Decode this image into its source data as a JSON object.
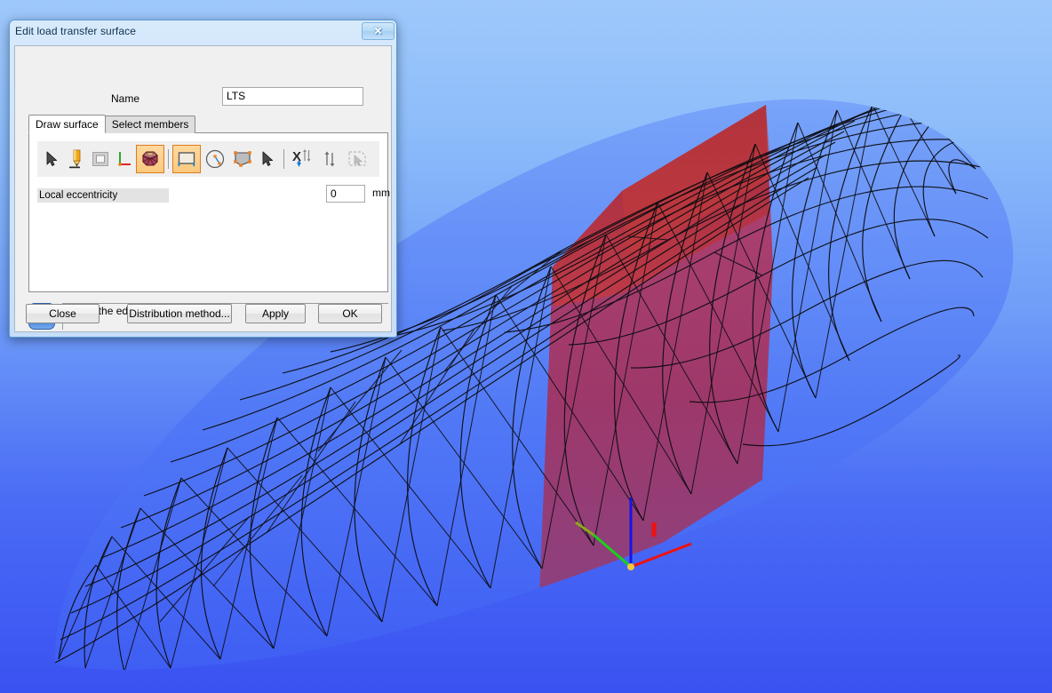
{
  "window": {
    "title": "Edit load transfer surface",
    "close_label": "✕",
    "close_icon": "close-icon"
  },
  "form": {
    "name_label": "Name",
    "name_value": "LTS"
  },
  "tabs": [
    {
      "label": "Draw surface",
      "active": true
    },
    {
      "label": "Select members",
      "active": false
    }
  ],
  "toolbar": {
    "items": [
      {
        "name": "select-arrow-icon",
        "icon": "arrow",
        "selected": false,
        "enabled": true
      },
      {
        "name": "draw-pencil-icon",
        "icon": "pencil",
        "selected": false,
        "enabled": true
      },
      {
        "name": "rectangle-plate-icon",
        "icon": "plate",
        "selected": false,
        "enabled": true
      },
      {
        "name": "coordinate-axes-icon",
        "icon": "axes",
        "selected": false,
        "enabled": true
      },
      {
        "name": "polygon-mesh-icon",
        "icon": "polymesh",
        "selected": true,
        "enabled": true
      },
      {
        "name": "draw-rectangle-icon",
        "icon": "rect-draw",
        "selected": true,
        "enabled": true
      },
      {
        "name": "draw-circle-icon",
        "icon": "circle-draw",
        "selected": false,
        "enabled": true
      },
      {
        "name": "edit-nodes-icon",
        "icon": "nodes-edit",
        "selected": false,
        "enabled": true
      },
      {
        "name": "pick-arrow-icon",
        "icon": "arrow",
        "selected": false,
        "enabled": true
      },
      {
        "name": "separator",
        "icon": "separator",
        "selected": false,
        "enabled": true
      },
      {
        "name": "delete-x-icon",
        "icon": "x-arrows",
        "selected": false,
        "enabled": true
      },
      {
        "name": "move-vertical-icon",
        "icon": "updown",
        "selected": false,
        "enabled": true
      },
      {
        "name": "select-region-icon",
        "icon": "region-pick",
        "selected": false,
        "enabled": false
      }
    ]
  },
  "eccentricity": {
    "label": "Local eccentricity",
    "value": "0",
    "unit": "mm"
  },
  "info": {
    "icon": "info-icon",
    "message": "Select the edge!"
  },
  "buttons": {
    "close": "Close",
    "distribution": "Distribution method...",
    "apply": "Apply",
    "ok": "OK"
  },
  "viewport": {
    "name": "3d-model-viewport",
    "background_top": "#9ec8fb",
    "background_bottom": "#3a52f2",
    "mesh_line_color": "#0d0d12",
    "surface_color": "#4a6cf5",
    "selected_surface_color": "#b32a55",
    "highlight_surface_color": "#c03030",
    "axes": {
      "x_color": "#ee1111",
      "y_color": "#22cc22",
      "z_color": "#1111ee",
      "origin_color": "#f2c83c"
    }
  }
}
